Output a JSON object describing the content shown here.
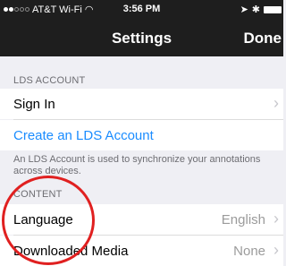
{
  "status_bar": {
    "carrier": "AT&T Wi-Fi",
    "time": "3:56 PM",
    "wifi_icon": "wifi-icon",
    "location_icon": "location-arrow-icon",
    "bluetooth_icon": "bluetooth-icon"
  },
  "nav": {
    "title": "Settings",
    "done_label": "Done"
  },
  "lds_account": {
    "header": "LDS ACCOUNT",
    "sign_in_label": "Sign In",
    "create_label": "Create an LDS Account",
    "footer": "An LDS Account is used to synchronize your annotations across devices."
  },
  "content": {
    "header": "CONTENT",
    "language_label": "Language",
    "language_value": "English",
    "downloaded_label": "Downloaded Media",
    "downloaded_value": "None"
  },
  "colors": {
    "link": "#1a8cff",
    "highlight_circle": "#e02020"
  }
}
